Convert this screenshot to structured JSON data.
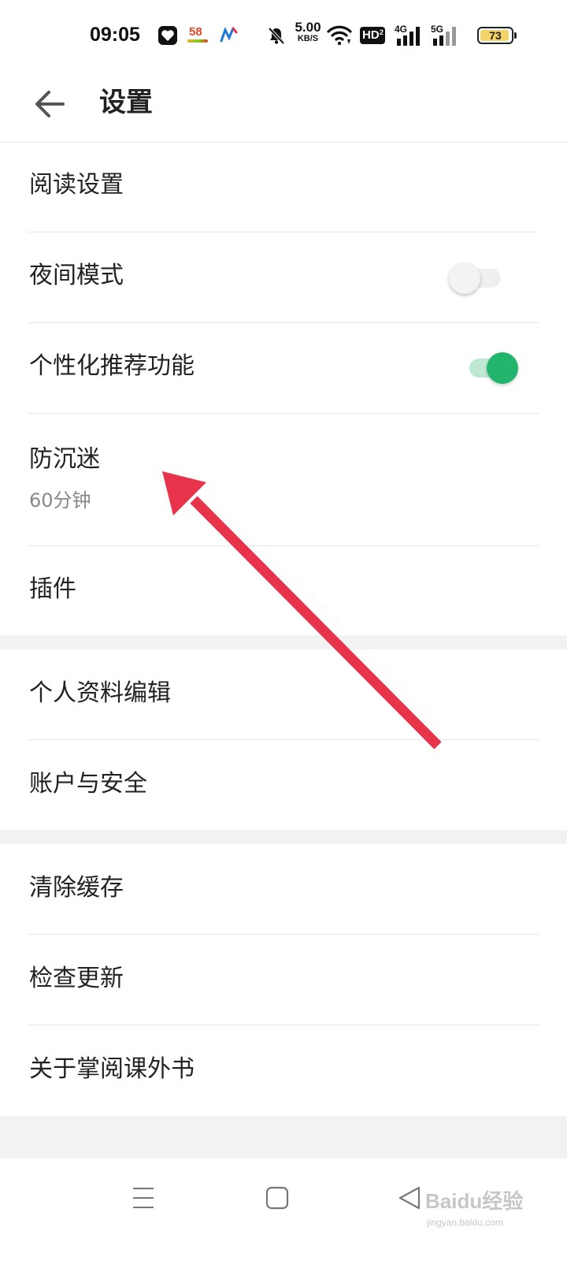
{
  "status_bar": {
    "time": "09:05",
    "net_speed_value": "5.00",
    "net_speed_unit": "KB/S",
    "hd_label": "HD",
    "hd_sub": "2",
    "sig1_label": "4G",
    "sig2_label": "5G",
    "battery_level": "73",
    "app58_label": "58",
    "icons": [
      "heart-app-icon",
      "58-app-icon",
      "tongcheng-app-icon",
      "mute-bell-icon",
      "wifi-icon",
      "hd-voice-icon",
      "signal-4g-icon",
      "signal-5g-icon",
      "battery-icon"
    ]
  },
  "header": {
    "back_icon": "arrow-left-icon",
    "title": "设置"
  },
  "groups": [
    {
      "items": [
        {
          "label": "阅读设置"
        },
        {
          "label": "夜间模式",
          "toggle": "off"
        },
        {
          "label": "个性化推荐功能",
          "toggle": "on"
        },
        {
          "label": "防沉迷",
          "sub": "60分钟"
        },
        {
          "label": "插件"
        }
      ]
    },
    {
      "items": [
        {
          "label": "个人资料编辑"
        },
        {
          "label": "账户与安全"
        }
      ]
    },
    {
      "items": [
        {
          "label": "清除缓存"
        },
        {
          "label": "检查更新"
        },
        {
          "label": "关于掌阅课外书"
        }
      ]
    }
  ],
  "annotation_arrow_color": "#e8344a",
  "colors": {
    "toggle_on": "#22b56c",
    "toggle_on_track": "#bfe8d2",
    "section_gap": "#f2f2f2"
  },
  "nav_bar": {
    "icons": [
      "menu-icon",
      "home-square-icon",
      "back-triangle-icon"
    ]
  },
  "watermark": {
    "text": "Baidu经验",
    "sub": "jingyan.baidu.com"
  }
}
